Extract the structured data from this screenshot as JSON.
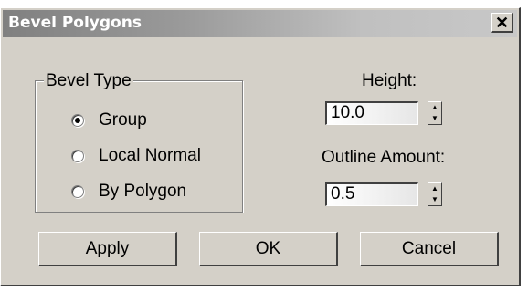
{
  "window": {
    "title": "Bevel Polygons",
    "close_glyph": "✕"
  },
  "bevel_type": {
    "label": "Bevel Type",
    "options": [
      {
        "label": "Group",
        "checked": true
      },
      {
        "label": "Local Normal",
        "checked": false
      },
      {
        "label": "By Polygon",
        "checked": false
      }
    ]
  },
  "height": {
    "label": "Height:",
    "value": "10.0"
  },
  "outline": {
    "label": "Outline Amount:",
    "value": "0.5"
  },
  "buttons": {
    "apply": "Apply",
    "ok": "OK",
    "cancel": "Cancel"
  },
  "spinner_glyphs": {
    "up": "▲",
    "down": "▼"
  }
}
